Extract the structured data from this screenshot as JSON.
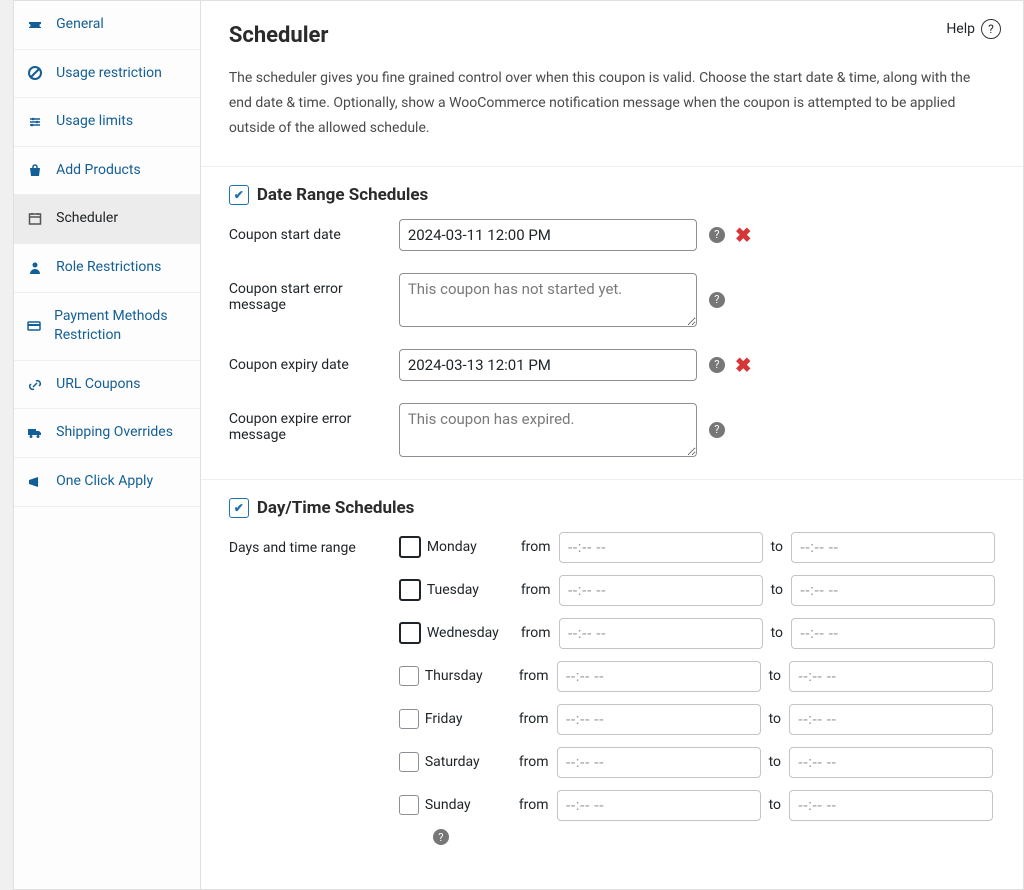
{
  "header": {
    "help": "Help"
  },
  "sidebar": {
    "items": [
      {
        "label": "General",
        "icon": "ticket"
      },
      {
        "label": "Usage restriction",
        "icon": "no-circle"
      },
      {
        "label": "Usage limits",
        "icon": "sliders"
      },
      {
        "label": "Add Products",
        "icon": "bag"
      },
      {
        "label": "Scheduler",
        "icon": "calendar"
      },
      {
        "label": "Role Restrictions",
        "icon": "person"
      },
      {
        "label": "Payment Methods Restriction",
        "icon": "card"
      },
      {
        "label": "URL Coupons",
        "icon": "link"
      },
      {
        "label": "Shipping Overrides",
        "icon": "truck"
      },
      {
        "label": "One Click Apply",
        "icon": "megaphone"
      }
    ]
  },
  "main": {
    "title": "Scheduler",
    "intro": "The scheduler gives you fine grained control over when this coupon is valid. Choose the start date & time, along with the end date & time. Optionally, show a WooCommerce notification message when the coupon is attempted to be applied outside of the allowed schedule.",
    "date_range": {
      "title": "Date Range Schedules",
      "enabled": true,
      "start_label": "Coupon start date",
      "start_value": "2024-03-11 12:00 PM",
      "start_error_label": "Coupon start error message",
      "start_error_placeholder": "This coupon has not started yet.",
      "expiry_label": "Coupon expiry date",
      "expiry_value": "2024-03-13 12:01 PM",
      "expire_error_label": "Coupon expire error message",
      "expire_error_placeholder": "This coupon has expired."
    },
    "day_time": {
      "title": "Day/Time Schedules",
      "enabled": true,
      "range_label": "Days and time range",
      "from": "from",
      "to": "to",
      "time_placeholder": "--:-- --",
      "days": [
        {
          "name": "Monday",
          "bold": true
        },
        {
          "name": "Tuesday",
          "bold": true
        },
        {
          "name": "Wednesday",
          "bold": true
        },
        {
          "name": "Thursday",
          "bold": false
        },
        {
          "name": "Friday",
          "bold": false
        },
        {
          "name": "Saturday",
          "bold": false
        },
        {
          "name": "Sunday",
          "bold": false
        }
      ]
    }
  }
}
